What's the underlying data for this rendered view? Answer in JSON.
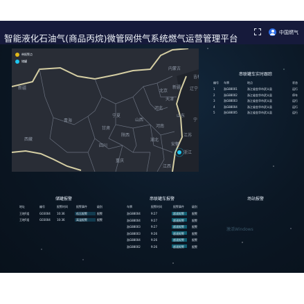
{
  "header": {
    "user_name": "中国燃气",
    "title": "智能液化石油气(商品丙烷)微管网供气系统燃气运营管理平台"
  },
  "map": {
    "legend": [
      {
        "label": "带报警点",
        "color": "#e0b81a"
      },
      {
        "label": "储罐",
        "color": "#1ec6f0"
      }
    ],
    "provinces": [
      "新疆",
      "西藏",
      "青海",
      "四川",
      "甘肃",
      "宁夏",
      "陕西",
      "山西",
      "河北",
      "北京",
      "天津",
      "内蒙古",
      "辽宁",
      "吉林",
      "山东",
      "河南",
      "江苏",
      "安徽",
      "湖北",
      "重庆",
      "浙江",
      "江西",
      "宁"
    ]
  },
  "truck_tracking": {
    "title": "串联罐车实时跟踪",
    "columns": [
      "编号",
      "车牌",
      "地点",
      "状态"
    ],
    "rows": [
      [
        "1",
        "浙G88001",
        "浙江省金华市武义县",
        "运行"
      ],
      [
        "2",
        "浙G88002",
        "浙江省金华市武义县",
        "停车"
      ],
      [
        "3",
        "浙G88003",
        "浙江省金华市武义县",
        "运行"
      ],
      [
        "4",
        "浙G88004",
        "浙江省金华市武义县",
        "运行"
      ],
      [
        "5",
        "浙G88005",
        "浙江省金华市武义县",
        "运行"
      ]
    ]
  },
  "tank_alarm": {
    "title": "储罐报警",
    "columns": [
      "地址",
      "编号",
      "报警时间",
      "报警事件",
      "级别"
    ],
    "rows": [
      [
        "王地F组",
        "G03004",
        "10:36",
        "低压报警",
        "报警"
      ],
      [
        "王地F组",
        "G03004",
        "10:36",
        "高温报警",
        "报警"
      ]
    ]
  },
  "truck_alarm": {
    "title": "串联罐车报警",
    "columns": [
      "车牌",
      "报警时间",
      "报警事件",
      "级别"
    ],
    "rows": [
      [
        "浙G88004",
        "9:27",
        "超速报警",
        "报警"
      ],
      [
        "浙G88004",
        "9:27",
        "超速报警",
        "报警"
      ],
      [
        "浙G88003",
        "9:27",
        "超速报警",
        "报警"
      ],
      [
        "浙G88003",
        "9:26",
        "超速报警",
        "报警"
      ],
      [
        "浙G88004",
        "9:26",
        "超速报警",
        "报警"
      ],
      [
        "浙G88002",
        "9:26",
        "超速报警",
        "报警"
      ]
    ]
  },
  "site_alarm": {
    "title": "场站报警"
  },
  "watermark": "激活Windows"
}
